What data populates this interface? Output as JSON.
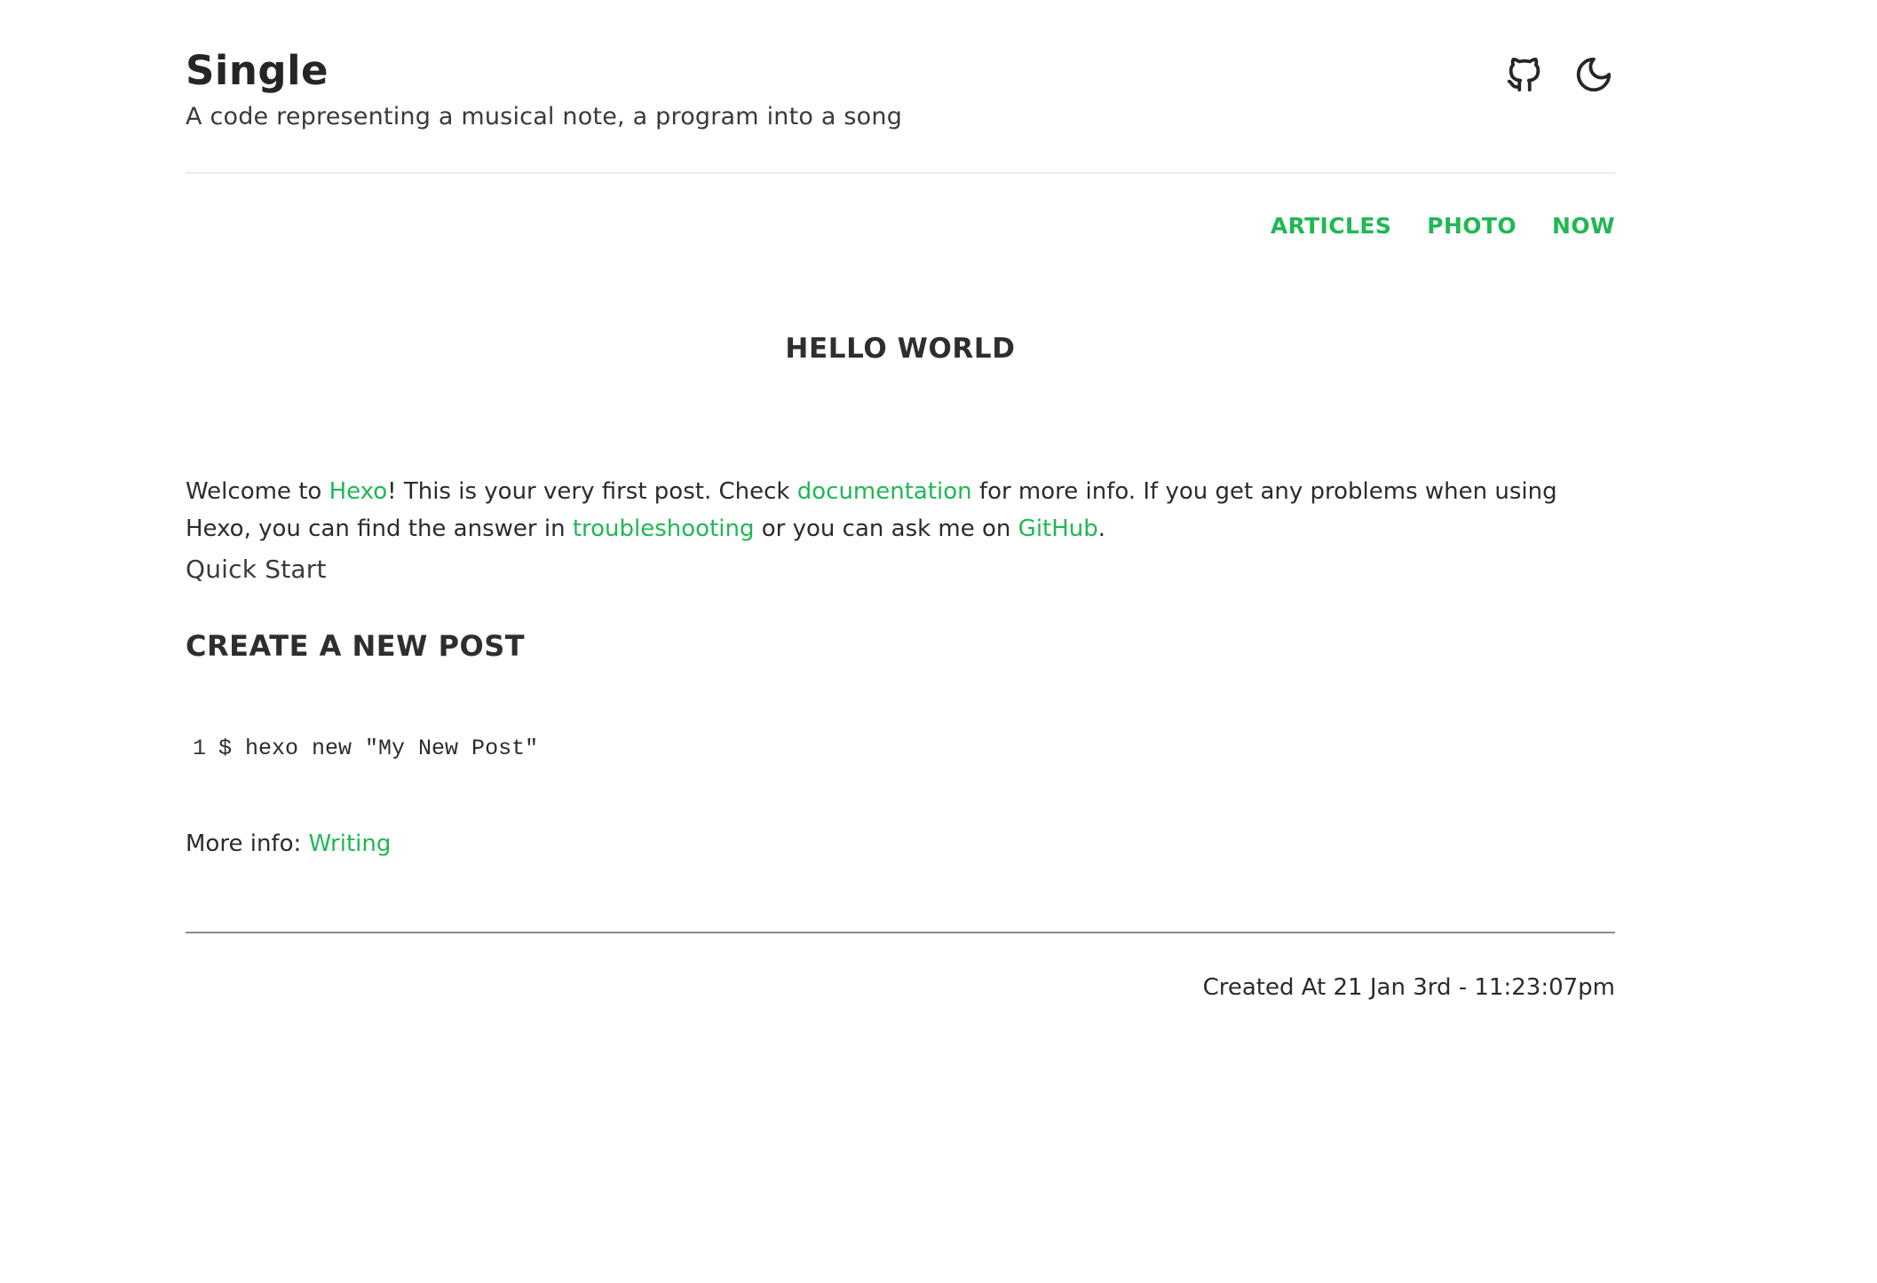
{
  "site": {
    "title": "Single",
    "subtitle": "A code representing a musical note, a program into a song",
    "icons": [
      "github-icon",
      "moon-icon"
    ]
  },
  "nav": {
    "items": [
      {
        "label": "ARTICLES"
      },
      {
        "label": "PHOTO"
      },
      {
        "label": "NOW"
      }
    ]
  },
  "post": {
    "title": "HELLO WORLD",
    "intro": {
      "t1": "Welcome to ",
      "link_hexo": "Hexo",
      "t2": "! This is your very first post. Check ",
      "link_docs": "documentation",
      "t3": " for more info. If you get any problems when using Hexo, you can find the answer in ",
      "link_troubleshooting": "troubleshooting",
      "t4": " or you can ask me on ",
      "link_github": "GitHub",
      "t5": "."
    },
    "quick_start": "Quick Start",
    "section_heading": "CREATE A NEW POST",
    "code": {
      "line_number": "1",
      "text": "$ hexo new \"My New Post\""
    },
    "more_info": {
      "label": "More info: ",
      "link": "Writing"
    },
    "created_at": "Created At 21 Jan 3rd - 11:23:07pm"
  },
  "colors": {
    "accent": "#1fb854",
    "text": "#2b2b2b",
    "background": "#ffffff"
  }
}
